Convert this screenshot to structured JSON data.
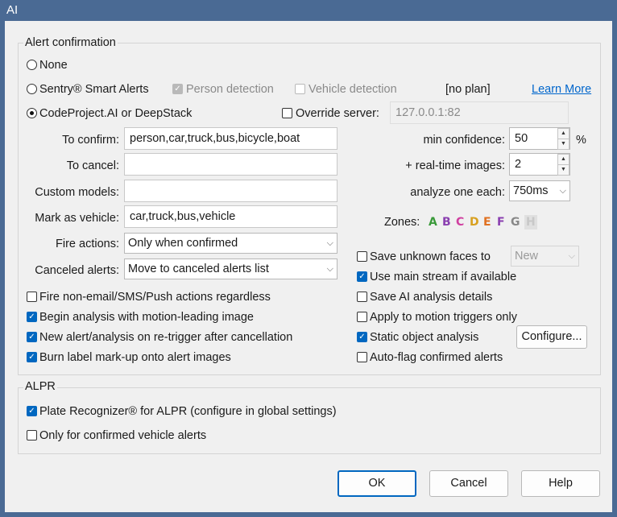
{
  "window": {
    "title": "AI"
  },
  "alert_confirmation": {
    "group_label": "Alert confirmation",
    "radio_none": {
      "label": "None",
      "selected": false
    },
    "radio_sentry": {
      "label": "Sentry® Smart Alerts",
      "selected": false
    },
    "person_detection": {
      "label": "Person detection",
      "checked": true,
      "enabled": false
    },
    "vehicle_detection": {
      "label": "Vehicle detection",
      "checked": false,
      "enabled": false
    },
    "plan_status": "[no plan]",
    "learn_more": "Learn More",
    "radio_codeproject": {
      "label": "CodeProject.AI or DeepStack",
      "selected": true
    },
    "override_server": {
      "label": "Override server:",
      "checked": false,
      "value": "127.0.0.1:82"
    },
    "to_confirm": {
      "label": "To confirm:",
      "value": "person,car,truck,bus,bicycle,boat"
    },
    "to_cancel": {
      "label": "To cancel:",
      "value": ""
    },
    "custom_models": {
      "label": "Custom models:",
      "value": ""
    },
    "mark_as_vehicle": {
      "label": "Mark as vehicle:",
      "value": "car,truck,bus,vehicle"
    },
    "fire_actions": {
      "label": "Fire actions:",
      "value": "Only when confirmed"
    },
    "canceled_alerts": {
      "label": "Canceled alerts:",
      "value": "Move to canceled alerts list"
    },
    "min_confidence": {
      "label": "min confidence:",
      "value": "50",
      "unit": "%"
    },
    "realtime_images": {
      "label": "+ real-time images:",
      "value": "2"
    },
    "analyze_one_each": {
      "label": "analyze one each:",
      "value": "750ms"
    },
    "zones": {
      "label": "Zones:",
      "letters": [
        {
          "letter": "A",
          "color": "#3a9a3a"
        },
        {
          "letter": "B",
          "color": "#8a3fb0"
        },
        {
          "letter": "C",
          "color": "#d040a0"
        },
        {
          "letter": "D",
          "color": "#d8a020"
        },
        {
          "letter": "E",
          "color": "#e07020"
        },
        {
          "letter": "F",
          "color": "#8a3fb0"
        },
        {
          "letter": "G",
          "color": "#888888"
        },
        {
          "letter": "H",
          "color": "#c8c8c8"
        }
      ]
    },
    "save_unknown_faces": {
      "label": "Save unknown faces to",
      "checked": false,
      "value": "New"
    },
    "use_main_stream": {
      "label": "Use main stream if available",
      "checked": true
    },
    "save_ai_details": {
      "label": "Save AI analysis details",
      "checked": false
    },
    "apply_to_motion": {
      "label": "Apply to motion triggers only",
      "checked": false
    },
    "static_object": {
      "label": "Static object analysis",
      "checked": true
    },
    "configure_button": "Configure...",
    "auto_flag": {
      "label": "Auto-flag confirmed alerts",
      "checked": false
    },
    "fire_non_email": {
      "label": "Fire non-email/SMS/Push actions regardless",
      "checked": false
    },
    "begin_analysis": {
      "label": "Begin analysis with motion-leading image",
      "checked": true
    },
    "new_alert_retrigger": {
      "label": "New alert/analysis on re-trigger after cancellation",
      "checked": true
    },
    "burn_label": {
      "label": "Burn label mark-up onto alert images",
      "checked": true
    }
  },
  "alpr": {
    "group_label": "ALPR",
    "plate_recognizer": {
      "label": "Plate Recognizer® for ALPR (configure in global settings)",
      "checked": true
    },
    "only_confirmed_vehicle": {
      "label": "Only for confirmed vehicle alerts",
      "checked": false
    }
  },
  "buttons": {
    "ok": "OK",
    "cancel": "Cancel",
    "help": "Help"
  },
  "colors": {
    "titlebar": "#4a6a94",
    "accent": "#0067c0",
    "link": "#0066cc"
  }
}
